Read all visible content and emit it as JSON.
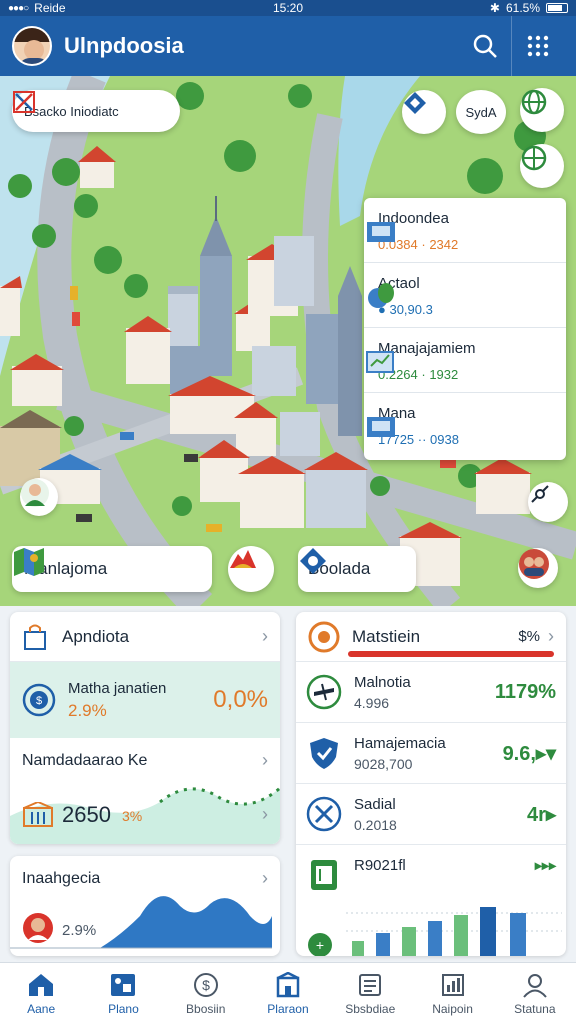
{
  "status_bar": {
    "carrier": "Reide",
    "time": "15:20",
    "battery": "61.5%"
  },
  "header": {
    "title": "Ulnpdoosia"
  },
  "map": {
    "search_chip_label": "Bsacko Iniodiatc",
    "currency_button_label": "SydA",
    "info_panel": [
      {
        "title": "Indoondea",
        "value": "0.0384 · 2342",
        "value_color": "#e07a2a",
        "icon": "box-icon"
      },
      {
        "title": "Actaol",
        "value": "● 30,90.3",
        "value_color": "#1f6fb3",
        "icon": "leaf-globe-icon"
      },
      {
        "title": "Manajajamiem",
        "value": "0.2264 · 1932",
        "value_color": "#2e8b3e",
        "icon": "chart-box-icon"
      },
      {
        "title": "Mana",
        "value": "17725 ·· 0938",
        "value_color": "#1f6fb3",
        "icon": "box-icon"
      }
    ],
    "place_chips": [
      {
        "label": "Manlajoma"
      },
      {
        "label": "Boolada"
      }
    ]
  },
  "left_card": {
    "title": "Apndiota",
    "highlight": {
      "label": "Matha janatien",
      "sub": "2.9%",
      "value": "0,0%"
    },
    "section2": {
      "title": "Namdadaarao Ke",
      "value": "2650",
      "sub": "3%"
    },
    "section3": {
      "title": "Inaahgecia",
      "value": "2.9%"
    }
  },
  "right_card": {
    "title": "Matstiein",
    "percent": "$%",
    "rows": [
      {
        "title": "Malnotia",
        "sub": "4.996",
        "value": "1179%"
      },
      {
        "title": "Hamajemacia",
        "sub": "9028,700",
        "value": "9.6,▸▾"
      },
      {
        "title": "Sadial",
        "sub": "0.2018",
        "value": "4r▸"
      },
      {
        "title": "R9021fl",
        "sub": "",
        "value": ""
      }
    ]
  },
  "bottom_nav": [
    {
      "label": "Aane",
      "icon": "home-icon",
      "active": true
    },
    {
      "label": "Plano",
      "icon": "plan-icon",
      "active": false
    },
    {
      "label": "Bbosiin",
      "icon": "dollar-icon",
      "active": false
    },
    {
      "label": "Plaraon",
      "icon": "building-icon",
      "active": false
    },
    {
      "label": "Sbsbdiae",
      "icon": "list-icon",
      "active": false
    },
    {
      "label": "Naipoin",
      "icon": "chart-icon",
      "active": false
    },
    {
      "label": "Statuna",
      "icon": "user-icon",
      "active": false
    }
  ],
  "colors": {
    "primary": "#1f5fa8",
    "accent_green": "#2e8b3e",
    "accent_orange": "#e07a2a",
    "accent_red": "#d9342b"
  }
}
